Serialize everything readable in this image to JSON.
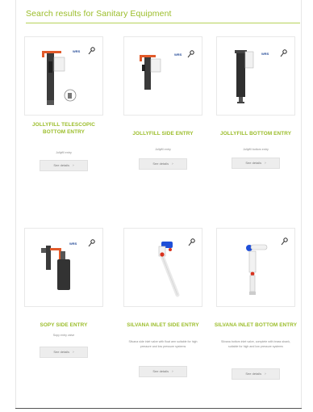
{
  "page": {
    "heading": "Search results for Sanitary Equipment"
  },
  "products": [
    {
      "title": "JOLLYFILL TELESCOPIC BOTTOM ENTRY",
      "description": "Jollyfill entry",
      "button": "See details",
      "icon": "fill-valve-telescopic"
    },
    {
      "title": "JOLLYFILL SIDE ENTRY",
      "description": "Jollyfill entry",
      "button": "See details",
      "icon": "fill-valve-side"
    },
    {
      "title": "JOLLYFILL BOTTOM ENTRY",
      "description": "Jollyfill bottom entry",
      "button": "See details",
      "icon": "fill-valve-bottom"
    },
    {
      "title": "SOPY SIDE ENTRY",
      "description": "Sopy entry valve",
      "button": "See details",
      "icon": "fill-valve-float"
    },
    {
      "title": "SILVANA INLET SIDE ENTRY",
      "description": "Silvana side inlet valve with float arm suitable for high pressure and low pressure systems",
      "button": "See details",
      "icon": "inlet-valve-side"
    },
    {
      "title": "SILVANA INLET BOTTOM ENTRY",
      "description": "Silvana bottom inlet valve, complete with brass shank, suitable for high and low pressure systems",
      "button": "See details",
      "icon": "inlet-valve-bottom"
    }
  ],
  "colors": {
    "accent": "#9bbd2a",
    "button_bg": "#ededed"
  }
}
